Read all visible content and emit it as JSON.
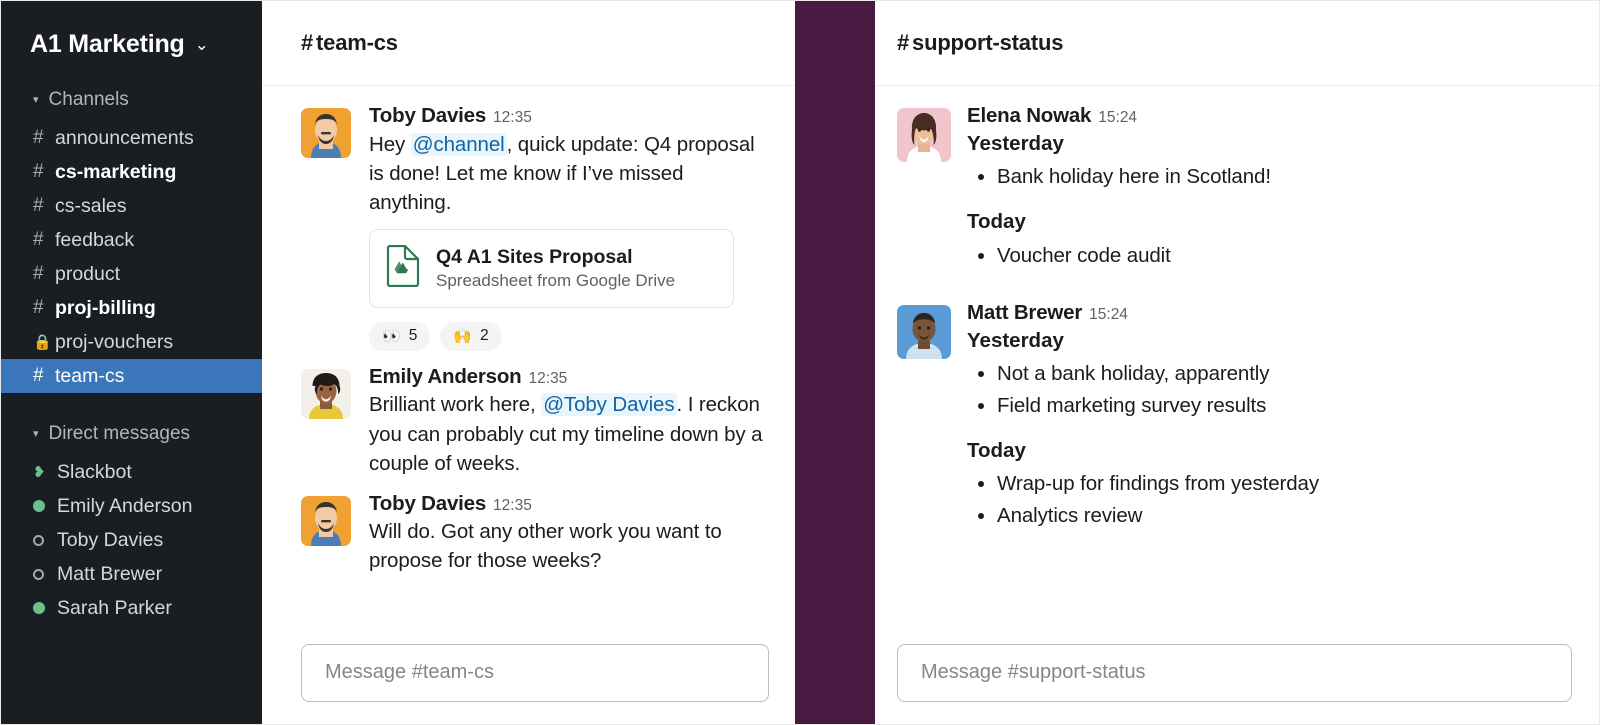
{
  "sidebar": {
    "workspace_name": "A1 Marketing",
    "workspace_chevron": "⌄",
    "channels_section": {
      "label": "Channels",
      "toggle": "▾"
    },
    "channels": [
      {
        "glyph": "#",
        "label": "announcements",
        "bold": false,
        "active": false,
        "private": false
      },
      {
        "glyph": "#",
        "label": "cs-marketing",
        "bold": true,
        "active": false,
        "private": false
      },
      {
        "glyph": "#",
        "label": "cs-sales",
        "bold": false,
        "active": false,
        "private": false
      },
      {
        "glyph": "#",
        "label": "feedback",
        "bold": false,
        "active": false,
        "private": false
      },
      {
        "glyph": "#",
        "label": "product",
        "bold": false,
        "active": false,
        "private": false
      },
      {
        "glyph": "#",
        "label": "proj-billing",
        "bold": true,
        "active": false,
        "private": false
      },
      {
        "glyph": "🔒",
        "label": "proj-vouchers",
        "bold": false,
        "active": false,
        "private": true
      },
      {
        "glyph": "#",
        "label": "team-cs",
        "bold": false,
        "active": true,
        "private": false
      }
    ],
    "dms_section": {
      "label": "Direct messages",
      "toggle": "▾"
    },
    "dms": [
      {
        "label": "Slackbot",
        "presence": "heart"
      },
      {
        "label": "Emily Anderson",
        "presence": "online"
      },
      {
        "label": "Toby Davies",
        "presence": "offline"
      },
      {
        "label": "Matt Brewer",
        "presence": "offline"
      },
      {
        "label": "Sarah Parker",
        "presence": "online"
      }
    ]
  },
  "left_panel": {
    "channel_hash": "#",
    "channel_name": "team-cs",
    "composer_placeholder": "Message #team-cs",
    "messages": [
      {
        "author": "Toby Davies",
        "time": "12:35",
        "text_before": "Hey ",
        "mention": "@channel",
        "text_after": ", quick update: Q4 proposal is done! Let me know if I’ve missed anything.",
        "attachment": {
          "title": "Q4 A1 Sites Proposal",
          "subtitle": "Spreadsheet from Google Drive",
          "icon": "google-drive-file-icon"
        },
        "reactions": [
          {
            "emoji": "👀",
            "name": "eyes-reaction",
            "count": "5"
          },
          {
            "emoji": "🙌",
            "name": "raised-hands-reaction",
            "count": "2"
          }
        ]
      },
      {
        "author": "Emily Anderson",
        "time": "12:35",
        "text_before": "Brilliant work here, ",
        "mention": "@Toby Davies",
        "text_after": ". I reckon you can probably cut my timeline down by a couple of weeks."
      },
      {
        "author": "Toby Davies",
        "time": "12:35",
        "text_before": "Will do. Got any other work you want to propose for those weeks?",
        "mention": "",
        "text_after": ""
      }
    ]
  },
  "right_panel": {
    "channel_hash": "#",
    "channel_name": "support-status",
    "composer_placeholder": "Message #support-status",
    "messages": [
      {
        "author": "Elena Nowak",
        "time": "15:24",
        "groups": [
          {
            "heading": "Yesterday",
            "items": [
              "Bank holiday here in Scotland!"
            ]
          },
          {
            "heading": "Today",
            "items": [
              "Voucher code audit"
            ]
          }
        ]
      },
      {
        "author": "Matt Brewer",
        "time": "15:24",
        "groups": [
          {
            "heading": "Yesterday",
            "items": [
              "Not a bank holiday, apparently",
              "Field marketing survey results"
            ]
          },
          {
            "heading": "Today",
            "items": [
              "Wrap-up for findings from yesterday",
              "Analytics review"
            ]
          }
        ]
      }
    ]
  },
  "colors": {
    "sidebar_bg": "#1a1d21",
    "active_channel": "#3b76ba",
    "strip_purple": "#4a1942",
    "mention_text": "#1264a3",
    "mention_bg": "#e8f5fa",
    "presence_online": "#6cc08b",
    "drive_green": "#2a7a52"
  }
}
